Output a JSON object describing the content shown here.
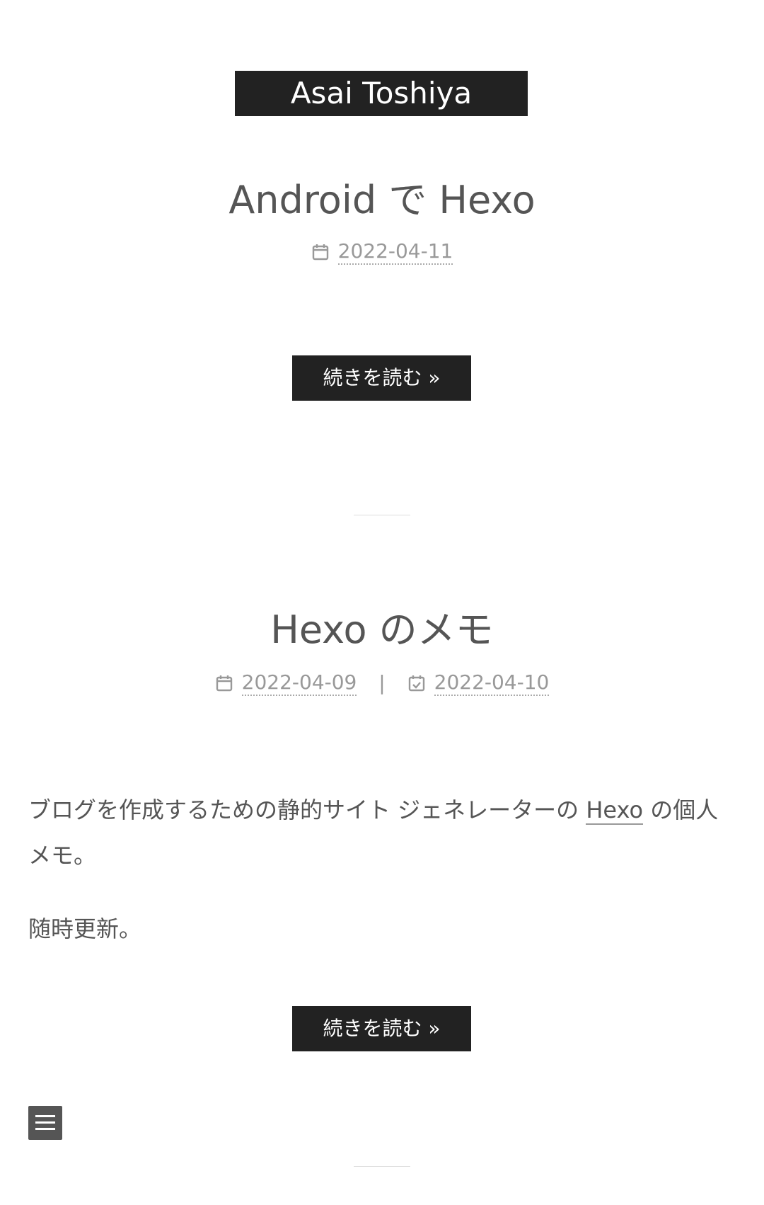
{
  "site": {
    "title": "Asai Toshiya"
  },
  "posts": [
    {
      "title": "Android で Hexo",
      "created": "2022-04-11",
      "read_more": "続きを読む »"
    },
    {
      "title": "Hexo のメモ",
      "created": "2022-04-09",
      "divider": "|",
      "updated": "2022-04-10",
      "body_p1_before": "ブログを作成するための静的サイト ジェネレーターの ",
      "body_p1_link": "Hexo",
      "body_p1_after": " の個人メモ。",
      "body_p2": "随時更新。",
      "read_more": "続きを読む »"
    }
  ],
  "icons": {
    "created": "calendar-icon",
    "updated": "calendar-check-icon",
    "menu": "menu-icon"
  },
  "colors": {
    "header_bg": "#222222",
    "button_bg": "#222222",
    "text": "#555555",
    "meta": "#999999"
  }
}
